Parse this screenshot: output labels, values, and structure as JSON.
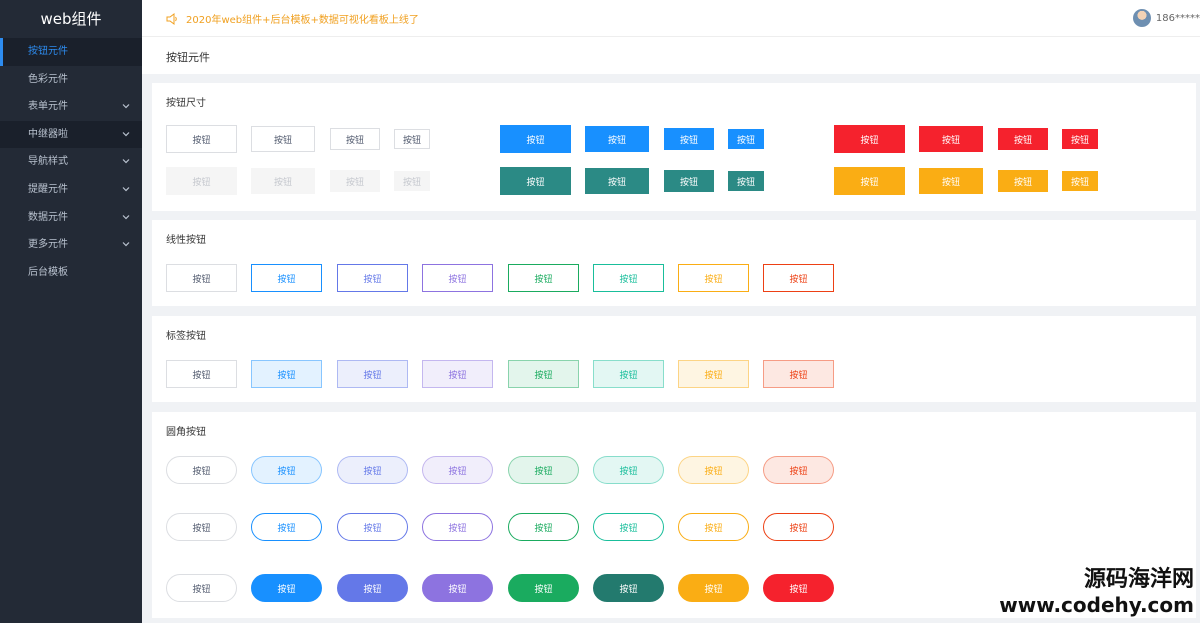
{
  "sidebar": {
    "title": "web组件",
    "items": [
      {
        "label": "按钮元件",
        "icon": ""
      },
      {
        "label": "色彩元件",
        "icon": ""
      },
      {
        "label": "表单元件",
        "icon": "chevron-down-icon"
      },
      {
        "label": "中继器啦",
        "icon": "chevron-down-icon"
      },
      {
        "label": "导航样式",
        "icon": "chevron-down-icon"
      },
      {
        "label": "提醒元件",
        "icon": "chevron-down-icon"
      },
      {
        "label": "数据元件",
        "icon": "chevron-down-icon"
      },
      {
        "label": "更多元件",
        "icon": "chevron-down-icon"
      },
      {
        "label": "后台模板",
        "icon": ""
      }
    ]
  },
  "header": {
    "notice": "2020年web组件+后台模板+数据可视化看板上线了",
    "notice_icon": "speaker-icon",
    "username": "186*****"
  },
  "page_title": "按钮元件",
  "btn_label": "按钮",
  "sections": {
    "size": "按钮尺寸",
    "outline": "线性按钮",
    "tag": "标签按钮",
    "round": "圆角按钮"
  },
  "colors": {
    "blue": "#1890ff",
    "teal": "#2b8a85",
    "red": "#f5222d",
    "orange": "#faad14",
    "indigo": "#6478e8",
    "purple": "#8d73e0",
    "green": "#1aab5f",
    "dark_teal": "#237a6e"
  },
  "watermark": {
    "line1": "源码海洋网",
    "line2": "www.codehy.com"
  }
}
